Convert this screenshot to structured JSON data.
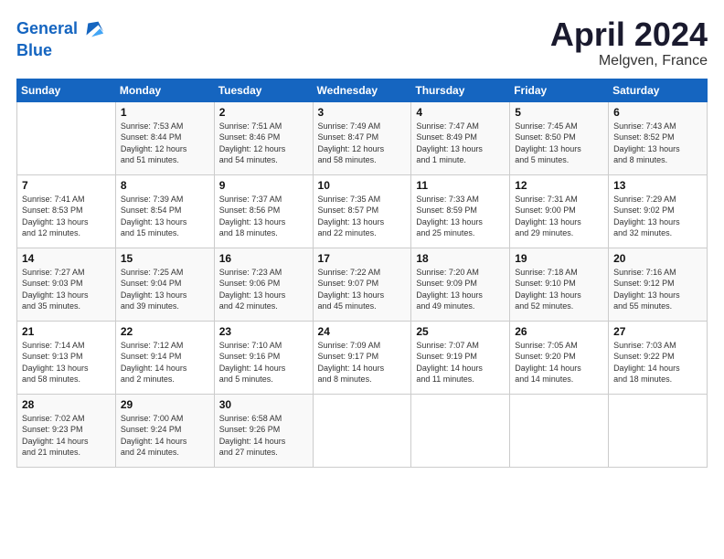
{
  "header": {
    "logo_line1": "General",
    "logo_line2": "Blue",
    "month": "April 2024",
    "location": "Melgven, France"
  },
  "weekdays": [
    "Sunday",
    "Monday",
    "Tuesday",
    "Wednesday",
    "Thursday",
    "Friday",
    "Saturday"
  ],
  "weeks": [
    [
      {
        "day": "",
        "info": ""
      },
      {
        "day": "1",
        "info": "Sunrise: 7:53 AM\nSunset: 8:44 PM\nDaylight: 12 hours\nand 51 minutes."
      },
      {
        "day": "2",
        "info": "Sunrise: 7:51 AM\nSunset: 8:46 PM\nDaylight: 12 hours\nand 54 minutes."
      },
      {
        "day": "3",
        "info": "Sunrise: 7:49 AM\nSunset: 8:47 PM\nDaylight: 12 hours\nand 58 minutes."
      },
      {
        "day": "4",
        "info": "Sunrise: 7:47 AM\nSunset: 8:49 PM\nDaylight: 13 hours\nand 1 minute."
      },
      {
        "day": "5",
        "info": "Sunrise: 7:45 AM\nSunset: 8:50 PM\nDaylight: 13 hours\nand 5 minutes."
      },
      {
        "day": "6",
        "info": "Sunrise: 7:43 AM\nSunset: 8:52 PM\nDaylight: 13 hours\nand 8 minutes."
      }
    ],
    [
      {
        "day": "7",
        "info": "Sunrise: 7:41 AM\nSunset: 8:53 PM\nDaylight: 13 hours\nand 12 minutes."
      },
      {
        "day": "8",
        "info": "Sunrise: 7:39 AM\nSunset: 8:54 PM\nDaylight: 13 hours\nand 15 minutes."
      },
      {
        "day": "9",
        "info": "Sunrise: 7:37 AM\nSunset: 8:56 PM\nDaylight: 13 hours\nand 18 minutes."
      },
      {
        "day": "10",
        "info": "Sunrise: 7:35 AM\nSunset: 8:57 PM\nDaylight: 13 hours\nand 22 minutes."
      },
      {
        "day": "11",
        "info": "Sunrise: 7:33 AM\nSunset: 8:59 PM\nDaylight: 13 hours\nand 25 minutes."
      },
      {
        "day": "12",
        "info": "Sunrise: 7:31 AM\nSunset: 9:00 PM\nDaylight: 13 hours\nand 29 minutes."
      },
      {
        "day": "13",
        "info": "Sunrise: 7:29 AM\nSunset: 9:02 PM\nDaylight: 13 hours\nand 32 minutes."
      }
    ],
    [
      {
        "day": "14",
        "info": "Sunrise: 7:27 AM\nSunset: 9:03 PM\nDaylight: 13 hours\nand 35 minutes."
      },
      {
        "day": "15",
        "info": "Sunrise: 7:25 AM\nSunset: 9:04 PM\nDaylight: 13 hours\nand 39 minutes."
      },
      {
        "day": "16",
        "info": "Sunrise: 7:23 AM\nSunset: 9:06 PM\nDaylight: 13 hours\nand 42 minutes."
      },
      {
        "day": "17",
        "info": "Sunrise: 7:22 AM\nSunset: 9:07 PM\nDaylight: 13 hours\nand 45 minutes."
      },
      {
        "day": "18",
        "info": "Sunrise: 7:20 AM\nSunset: 9:09 PM\nDaylight: 13 hours\nand 49 minutes."
      },
      {
        "day": "19",
        "info": "Sunrise: 7:18 AM\nSunset: 9:10 PM\nDaylight: 13 hours\nand 52 minutes."
      },
      {
        "day": "20",
        "info": "Sunrise: 7:16 AM\nSunset: 9:12 PM\nDaylight: 13 hours\nand 55 minutes."
      }
    ],
    [
      {
        "day": "21",
        "info": "Sunrise: 7:14 AM\nSunset: 9:13 PM\nDaylight: 13 hours\nand 58 minutes."
      },
      {
        "day": "22",
        "info": "Sunrise: 7:12 AM\nSunset: 9:14 PM\nDaylight: 14 hours\nand 2 minutes."
      },
      {
        "day": "23",
        "info": "Sunrise: 7:10 AM\nSunset: 9:16 PM\nDaylight: 14 hours\nand 5 minutes."
      },
      {
        "day": "24",
        "info": "Sunrise: 7:09 AM\nSunset: 9:17 PM\nDaylight: 14 hours\nand 8 minutes."
      },
      {
        "day": "25",
        "info": "Sunrise: 7:07 AM\nSunset: 9:19 PM\nDaylight: 14 hours\nand 11 minutes."
      },
      {
        "day": "26",
        "info": "Sunrise: 7:05 AM\nSunset: 9:20 PM\nDaylight: 14 hours\nand 14 minutes."
      },
      {
        "day": "27",
        "info": "Sunrise: 7:03 AM\nSunset: 9:22 PM\nDaylight: 14 hours\nand 18 minutes."
      }
    ],
    [
      {
        "day": "28",
        "info": "Sunrise: 7:02 AM\nSunset: 9:23 PM\nDaylight: 14 hours\nand 21 minutes."
      },
      {
        "day": "29",
        "info": "Sunrise: 7:00 AM\nSunset: 9:24 PM\nDaylight: 14 hours\nand 24 minutes."
      },
      {
        "day": "30",
        "info": "Sunrise: 6:58 AM\nSunset: 9:26 PM\nDaylight: 14 hours\nand 27 minutes."
      },
      {
        "day": "",
        "info": ""
      },
      {
        "day": "",
        "info": ""
      },
      {
        "day": "",
        "info": ""
      },
      {
        "day": "",
        "info": ""
      }
    ]
  ]
}
